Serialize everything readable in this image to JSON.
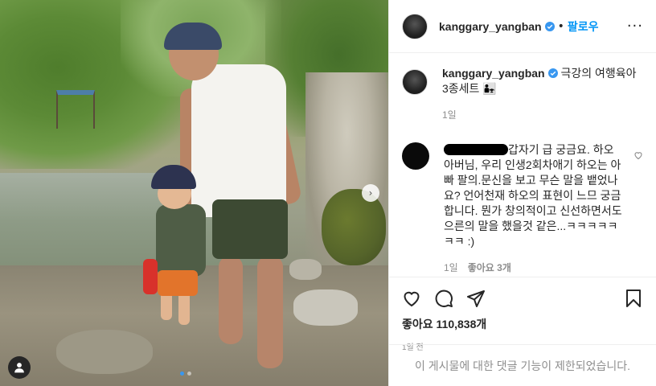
{
  "post": {
    "username": "kanggary_yangban",
    "follow_label": "팔로우",
    "separator": "•",
    "more_label": "···",
    "caption": "극강의 여행육아 3종세트 👨‍👧",
    "caption_age": "1일"
  },
  "comment": {
    "text": "갑자기 급 궁금요. 하오 아버님, 우리 인생2회차애기 하오는 아빠 팔의.문신을 보고 무슨 말을 뱉었나요? 언어천재 하오의 표현이 느므 궁금합니다. 뭔가 창의적이고 신선하면서도 으른의 말을 했을것 같은...ㅋㅋㅋㅋㅋㅋㅋ :)",
    "age": "1일",
    "likes": "좋아요 3개"
  },
  "stats": {
    "likes": "좋아요 110,838개",
    "posted_ago": "1일 전"
  },
  "footer": {
    "comments_disabled": "이 게시물에 대한 댓글 기능이 제한되었습니다."
  },
  "carousel": {
    "next_label": "›",
    "total_slides": 2,
    "active_slide": 1
  },
  "colors": {
    "accent": "#0095f6",
    "verified": "#3897f0",
    "muted": "#8e8e8e",
    "text": "#262626"
  },
  "icons": [
    "verified-badge-icon",
    "heart-icon",
    "comment-icon",
    "share-icon",
    "bookmark-icon",
    "user-tag-icon",
    "chevron-right-icon",
    "more-icon"
  ]
}
